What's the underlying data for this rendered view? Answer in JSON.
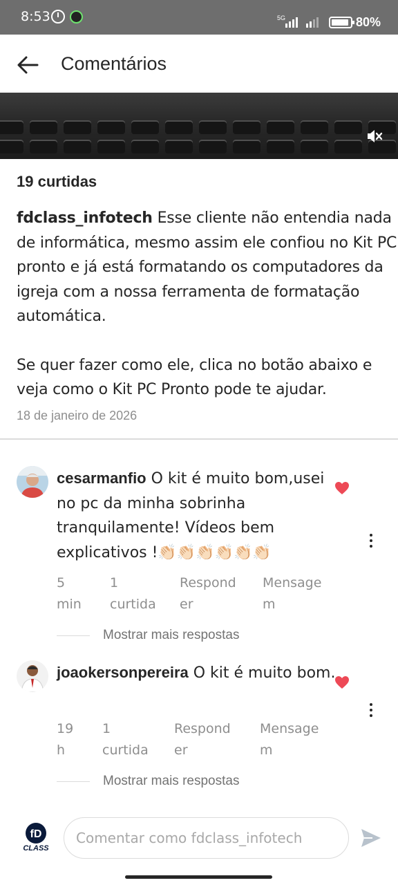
{
  "status_bar": {
    "time": "8:53",
    "network": "5G",
    "battery": "80%"
  },
  "header": {
    "title": "Comentários",
    "back_icon": "arrow-left-icon"
  },
  "video": {
    "mute_icon": "volume-off-icon"
  },
  "post": {
    "likes": "19 curtidas",
    "author": "fdclass_infotech",
    "caption_p1": "Esse cliente não entendia nada de informática, mesmo assim ele confiou no Kit PC pronto e já está formatando os computadores da igreja com a nossa ferramenta de formatação automática.",
    "caption_p2": "Se quer fazer como ele, clica no botão abaixo e veja como o Kit PC Pronto pode te ajudar.",
    "date": "18 de janeiro de 2026"
  },
  "comments": [
    {
      "user": "cesarmanfio",
      "text": "O kit é muito bom,usei no pc da minha sobrinha tranquilamente! Vídeos bem explicativos !👏🏻👏🏻👏🏻👏🏻👏🏻👏🏻",
      "time_l1": "5",
      "time_l2": "min",
      "likes_l1": "1",
      "likes_l2": "curtida",
      "reply_l1": "Respond",
      "reply_l2": "er",
      "message_l1": "Mensage",
      "message_l2": "m",
      "more_replies": "Mostrar mais respostas",
      "liked": true
    },
    {
      "user": "joaokersonpereira",
      "text": "O kit é muito bom.",
      "time_l1": "19",
      "time_l2": "h",
      "likes_l1": "1",
      "likes_l2": "curtida",
      "reply_l1": "Respond",
      "reply_l2": "er",
      "message_l1": "Mensage",
      "message_l2": "m",
      "more_replies": "Mostrar mais respostas",
      "liked": true
    }
  ],
  "composer": {
    "avatar_label": "CLASS",
    "placeholder": "Comentar como fdclass_infotech",
    "send_icon": "send-icon"
  },
  "colors": {
    "heart": "#ed4956",
    "secondary_text": "#8e8e8e",
    "primary_text": "#262626"
  }
}
